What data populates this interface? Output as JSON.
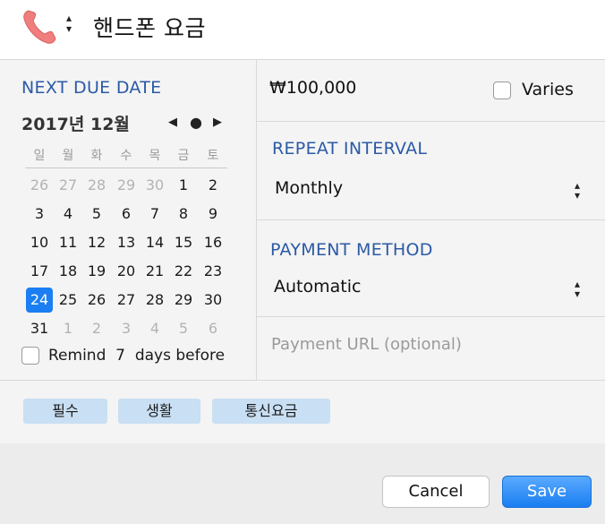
{
  "header": {
    "title": "핸드폰 요금",
    "icon": "phone-icon",
    "icon_color": "#f07e7e"
  },
  "due_date": {
    "label": "NEXT DUE DATE",
    "month_title": "2017년 12월",
    "nav": {
      "prev": "◀",
      "today": "●",
      "next": "▶"
    },
    "weekdays": [
      "일",
      "월",
      "화",
      "수",
      "목",
      "금",
      "토"
    ],
    "weeks": [
      [
        {
          "d": "26",
          "o": true
        },
        {
          "d": "27",
          "o": true
        },
        {
          "d": "28",
          "o": true
        },
        {
          "d": "29",
          "o": true
        },
        {
          "d": "30",
          "o": true
        },
        {
          "d": "1"
        },
        {
          "d": "2"
        }
      ],
      [
        {
          "d": "3"
        },
        {
          "d": "4"
        },
        {
          "d": "5"
        },
        {
          "d": "6"
        },
        {
          "d": "7"
        },
        {
          "d": "8"
        },
        {
          "d": "9"
        }
      ],
      [
        {
          "d": "10"
        },
        {
          "d": "11"
        },
        {
          "d": "12"
        },
        {
          "d": "13"
        },
        {
          "d": "14"
        },
        {
          "d": "15"
        },
        {
          "d": "16"
        }
      ],
      [
        {
          "d": "17"
        },
        {
          "d": "18"
        },
        {
          "d": "19"
        },
        {
          "d": "20"
        },
        {
          "d": "21"
        },
        {
          "d": "22"
        },
        {
          "d": "23"
        }
      ],
      [
        {
          "d": "24",
          "s": true
        },
        {
          "d": "25"
        },
        {
          "d": "26"
        },
        {
          "d": "27"
        },
        {
          "d": "28"
        },
        {
          "d": "29"
        },
        {
          "d": "30"
        }
      ],
      [
        {
          "d": "31"
        },
        {
          "d": "1",
          "o": true
        },
        {
          "d": "2",
          "o": true
        },
        {
          "d": "3",
          "o": true
        },
        {
          "d": "4",
          "o": true
        },
        {
          "d": "5",
          "o": true
        },
        {
          "d": "6",
          "o": true
        }
      ]
    ],
    "selected_color": "#1b7ef2",
    "remind": {
      "prefix": "Remind",
      "days": "7",
      "suffix": "days before",
      "checked": false
    }
  },
  "amount": {
    "value": "₩100,000",
    "varies_label": "Varies",
    "varies_checked": false
  },
  "repeat": {
    "label": "REPEAT INTERVAL",
    "value": "Monthly"
  },
  "payment": {
    "label": "PAYMENT METHOD",
    "value": "Automatic",
    "url_placeholder": "Payment URL (optional)"
  },
  "tags": [
    "필수",
    "생활",
    "통신요금"
  ],
  "buttons": {
    "cancel": "Cancel",
    "save": "Save"
  },
  "colors": {
    "accent": "#2b5aa5",
    "tag_bg": "#c9dff3",
    "save": "#1a7ef0"
  }
}
